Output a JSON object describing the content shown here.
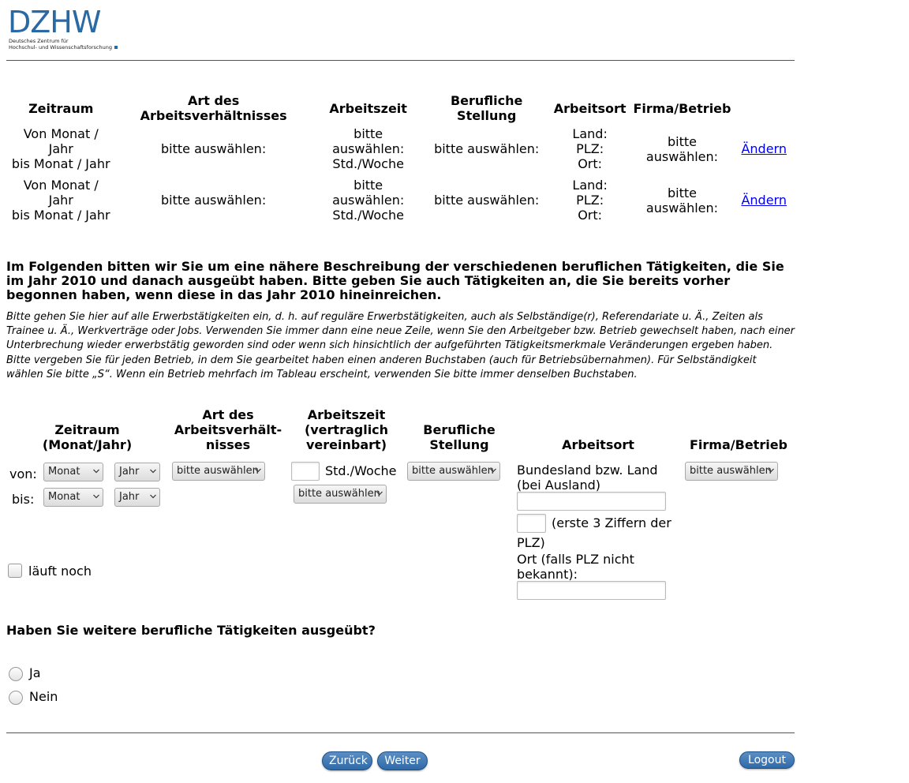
{
  "logo": {
    "letters": "DZHW",
    "line1": "Deutsches Zentrum für",
    "line2": "Hochschul- und Wissenschaftsforschung"
  },
  "summary": {
    "headers": {
      "zeitraum": "Zeitraum",
      "art": "Art des Arbeitsverhältnisses",
      "arbeitszeit": "Arbeitszeit",
      "stellung": "Berufliche Stellung",
      "arbeitsort": "Arbeitsort",
      "firma": "Firma/Betrieb"
    },
    "rows": [
      {
        "zeitraum_l1": "Von Monat /",
        "zeitraum_l2": "Jahr",
        "zeitraum_l3": "bis Monat / Jahr",
        "art": "bitte auswählen:",
        "az_l1": "bitte",
        "az_l2": "auswählen:",
        "az_l3": "Std./Woche",
        "stellung": "bitte auswählen:",
        "ort_l1": "Land:",
        "ort_l2": "PLZ:",
        "ort_l3": "Ort:",
        "firma_l1": "bitte",
        "firma_l2": "auswählen:",
        "edit": "Ändern"
      },
      {
        "zeitraum_l1": "Von Monat /",
        "zeitraum_l2": "Jahr",
        "zeitraum_l3": "bis Monat / Jahr",
        "art": "bitte auswählen:",
        "az_l1": "bitte",
        "az_l2": "auswählen:",
        "az_l3": "Std./Woche",
        "stellung": "bitte auswählen:",
        "ort_l1": "Land:",
        "ort_l2": "PLZ:",
        "ort_l3": "Ort:",
        "firma_l1": "bitte",
        "firma_l2": "auswählen:",
        "edit": "Ändern"
      }
    ]
  },
  "intro": {
    "bold": "Im Folgenden bitten wir Sie um eine nähere Beschreibung der verschiedenen beruflichen Tätigkeiten, die Sie im Jahr 2010 und danach ausgeübt haben. Bitte geben Sie auch Tätigkeiten an, die Sie bereits vorher begonnen haben, wenn diese in das Jahr 2010 hineinreichen.",
    "italic1": "Bitte gehen Sie hier auf alle Erwerbstätigkeiten ein, d. h. auf reguläre Erwerbstätigkeiten, auch als Selbständige(r), Referendariate u. Ä., Zeiten als Trainee u. Ä., Werkverträge oder Jobs. Verwenden Sie immer dann eine neue Zeile, wenn Sie den Arbeitgeber bzw. Betrieb gewechselt haben, nach einer Unterbrechung wieder erwerbstätig geworden sind oder wenn sich hinsichtlich der aufgeführten Tätigkeitsmerkmale Veränderungen ergeben haben.",
    "italic2": "Bitte vergeben Sie für jeden Betrieb, in dem Sie gearbeitet haben einen anderen Buchstaben (auch für Betriebsübernahmen). Für Selbständigkeit wählen Sie bitte „S“. Wenn ein Betrieb mehrfach im Tableau erscheint, verwenden Sie bitte immer denselben Buchstaben."
  },
  "entry": {
    "headers": {
      "zeitraum_l1": "Zeitraum",
      "zeitraum_l2": "(Monat/Jahr)",
      "art_l1": "Art des",
      "art_l2": "Arbeitsverhält-",
      "art_l3": "nisses",
      "az_l1": "Arbeitszeit",
      "az_l2": "(vertraglich",
      "az_l3": "vereinbart)",
      "stellung_l1": "Berufliche",
      "stellung_l2": "Stellung",
      "arbeitsort": "Arbeitsort",
      "firma": "Firma/Betrieb"
    },
    "von_label": "von:",
    "bis_label": "bis:",
    "monat": "Monat",
    "jahr": "Jahr",
    "select_placeholder": "bitte auswählen",
    "std_woche": "Std./Woche",
    "bundesland_l1": "Bundesland bzw. Land",
    "bundesland_l2": "(bei Ausland)",
    "plz_l1": "(erste 3 Ziffern der",
    "plz_l2": "PLZ)",
    "ort_l1": "Ort (falls PLZ nicht",
    "ort_l2": "bekannt):",
    "laeuft_noch": "läuft noch"
  },
  "question": {
    "text": "Haben Sie weitere berufliche Tätigkeiten ausgeübt?",
    "yes": "Ja",
    "no": "Nein"
  },
  "nav": {
    "back": "Zurück",
    "next": "Weiter",
    "logout": "Logout"
  }
}
